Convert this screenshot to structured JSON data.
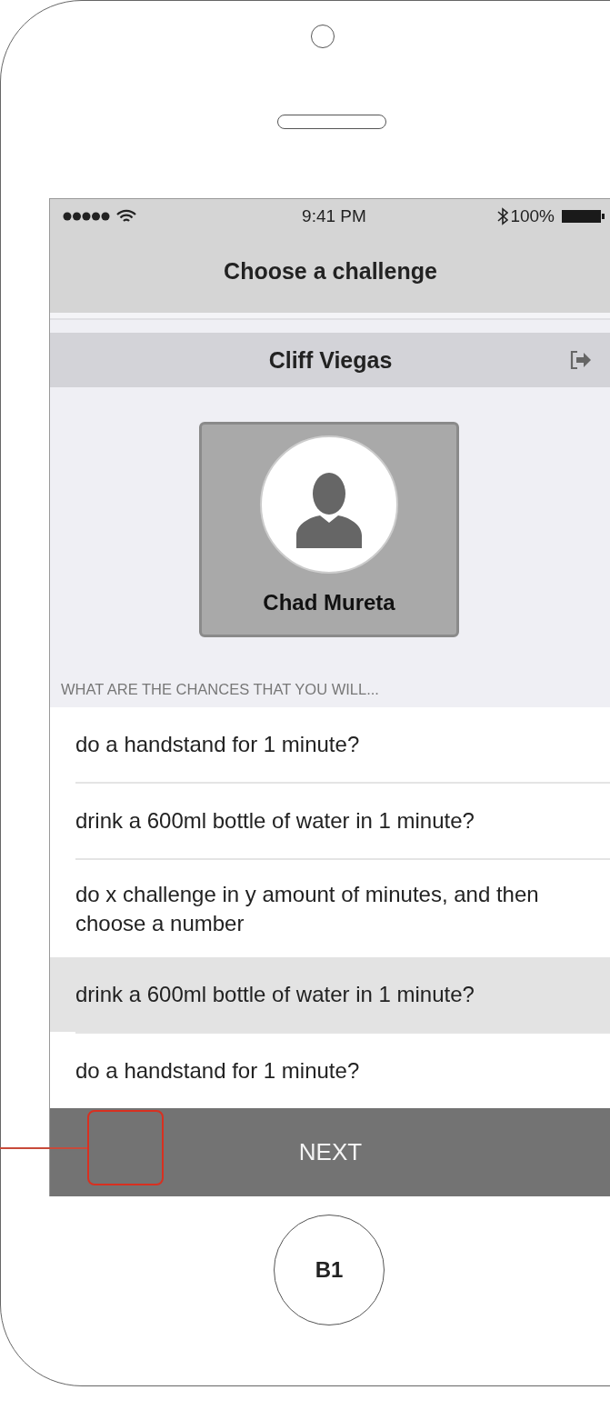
{
  "status_bar": {
    "time": "9:41 PM",
    "battery": "100%"
  },
  "nav_bar": {
    "title": "Choose a challenge"
  },
  "user_bar": {
    "name": "Cliff Viegas"
  },
  "profile_card": {
    "name": "Chad Mureta"
  },
  "section_header": "WHAT ARE THE CHANCES THAT YOU WILL...",
  "challenges": [
    {
      "text": "do a handstand for 1 minute?",
      "selected": false
    },
    {
      "text": "drink a 600ml bottle of water in 1 minute?",
      "selected": false
    },
    {
      "text": "do x challenge in y amount of minutes, and then choose a number",
      "selected": false
    },
    {
      "text": "drink a 600ml bottle of water in 1 minute?",
      "selected": true
    },
    {
      "text": "do a handstand for 1 minute?",
      "selected": false
    }
  ],
  "next_button": "NEXT",
  "home_button": "B1"
}
